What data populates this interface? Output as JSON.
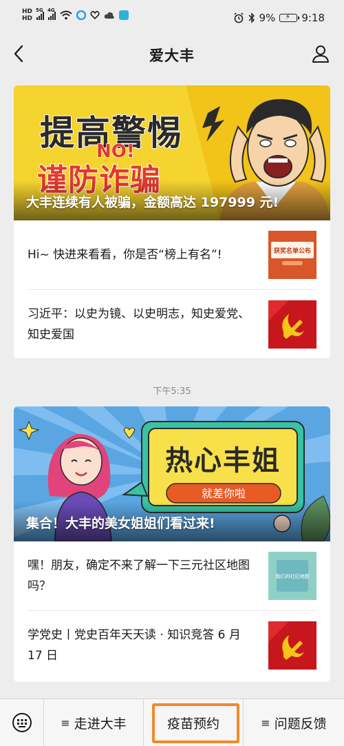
{
  "status_bar": {
    "left_badges": [
      "HD",
      "HD"
    ],
    "network": [
      "5G",
      "4G"
    ],
    "battery_percent": "9%",
    "time": "9:18",
    "icons": [
      "wifi-icon",
      "app-icon",
      "health-icon",
      "cloud-icon",
      "app-square-icon",
      "alarm-icon",
      "bluetooth-icon",
      "battery-icon"
    ]
  },
  "nav": {
    "title": "爱大丰",
    "back_icon": "back-arrow-icon",
    "profile_icon": "user-profile-icon"
  },
  "feed": [
    {
      "banner": {
        "headline_line1": "提高警惕",
        "headline_no": "NO!",
        "headline_line2": "谨防诈骗",
        "caption": "大丰连续有人被骗，金额高达 197999 元!",
        "background_color": "#f5d430"
      },
      "articles": [
        {
          "title": "Hi~ 快进来看看，你是否“榜上有名”!",
          "thumb_text": "获奖名单公布",
          "thumb_color": "#d9552a"
        },
        {
          "title": "习近平：以史为镜、以史明志，知史爱党、知史爱国",
          "thumb_icon": "party-emblem-icon",
          "thumb_color": "#c8161d"
        }
      ]
    },
    {
      "time": "下午5:35",
      "banner": {
        "headline": "热心丰姐",
        "button": "就差你啦",
        "caption": "集合！大丰的美女姐姐们看过来!",
        "background_color": "#5aa6e2"
      },
      "articles": [
        {
          "title": "嘿！朋友，确定不来了解一下三元社区地图吗？",
          "thumb_text": "我们的社区地图",
          "thumb_color": "#8fd0c6"
        },
        {
          "title": "学党史丨党史百年天天读 · 知识竞答 6 月 17 日",
          "thumb_icon": "party-emblem-icon",
          "thumb_color": "#c8161d"
        }
      ]
    }
  ],
  "bottom_menu": {
    "keyboard_icon": "keyboard-icon",
    "items": [
      {
        "label": "走进大丰",
        "icon": "menu-list-icon"
      },
      {
        "label": "疫苗预约",
        "highlighted": true
      },
      {
        "label": "问题反馈",
        "icon": "menu-list-icon"
      }
    ],
    "highlight_color": "#ef8a2c"
  }
}
